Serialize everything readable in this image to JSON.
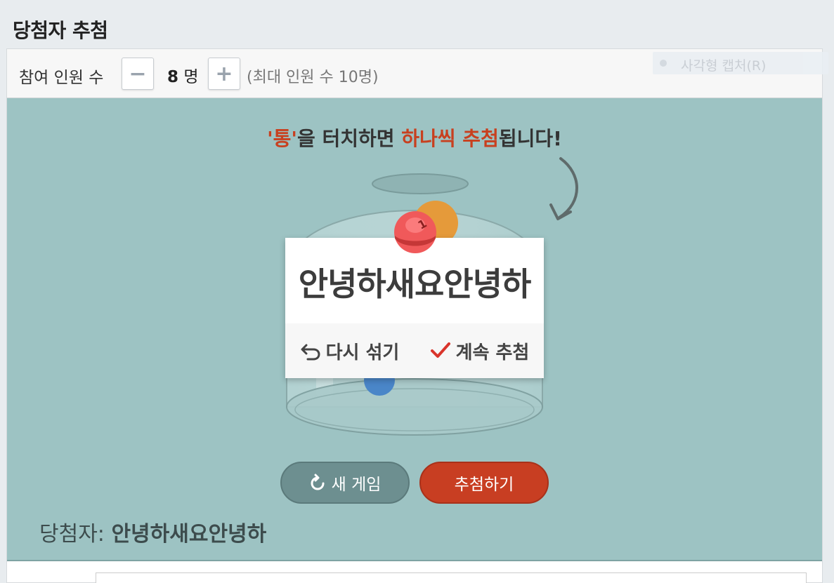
{
  "page": {
    "title": "당첨자 추첨"
  },
  "toolbar": {
    "participants_label": "참여 인원 수",
    "minus_label": "−",
    "plus_label": "+",
    "count_value": "8",
    "count_unit": "명",
    "max_text": "(최대 인원 수 10명)"
  },
  "capture": {
    "label": "사각형 캡처(R)"
  },
  "stage": {
    "instruction": {
      "part1": "'통'",
      "part2": "을 터치하면 ",
      "part3": "하나씩 추첨",
      "part4": "됩니다!"
    },
    "ball_number": "1",
    "result": {
      "name": "안녕하새요안녕하",
      "reshuffle_label": "다시 섞기",
      "continue_label": "계속 추첨"
    },
    "new_game_label": "새 게임",
    "draw_label": "추첨하기",
    "winner_prefix": "당첨자: ",
    "winner_name": "안녕하새요안녕하"
  },
  "colors": {
    "accent_red": "#c8401f",
    "stage_bg": "#9dc3c3",
    "new_game_bg": "#6d8f90",
    "draw_bg": "#c83e22"
  },
  "icons": [
    "undo-icon",
    "check-icon",
    "refresh-icon",
    "curved-arrow-icon"
  ]
}
